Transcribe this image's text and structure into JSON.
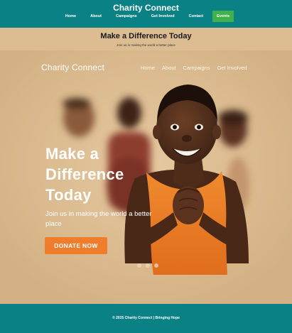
{
  "header": {
    "site_title": "Charity Connect",
    "nav": [
      {
        "label": "Home"
      },
      {
        "label": "About"
      },
      {
        "label": "Campaigns"
      },
      {
        "label": "Get Involved"
      },
      {
        "label": "Contact"
      },
      {
        "label": "Events"
      }
    ]
  },
  "intro": {
    "title": "Make a Difference Today",
    "subtitle": "Join us in making the world a better place"
  },
  "hero": {
    "brand": "Charity Connect",
    "nav": [
      {
        "label": "Home"
      },
      {
        "label": "About"
      },
      {
        "label": "Campaigns"
      },
      {
        "label": "Get Involved"
      }
    ],
    "headline": "Make a Difference Today",
    "subtitle": "Join us in making the world a better place",
    "cta_label": "DONATE NOW",
    "slides": 3,
    "active_slide": 1
  },
  "footer": {
    "text": "© 2025 Charity Connect | Bringing Hope"
  },
  "colors": {
    "header_bg": "#0a8285",
    "page_bg": "#dcbd92",
    "events_button": "#41b14c",
    "donate_button": "#ef7d2b"
  }
}
